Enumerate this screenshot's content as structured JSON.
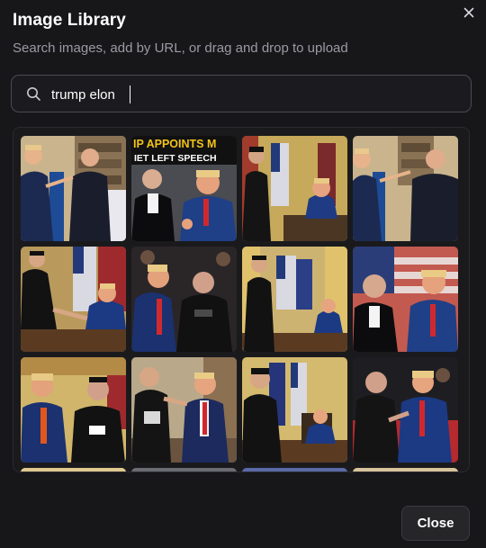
{
  "dialog": {
    "title": "Image Library",
    "subtitle": "Search images, add by URL, or drag and drop to upload"
  },
  "search": {
    "value": "trump elon",
    "icon": "search-icon"
  },
  "thumb_text": {
    "banner_line1": "IP APPOINTS M",
    "banner_line2": "IET LEFT SPEECH"
  },
  "results": [
    {
      "scene": "bookshelf-pointing"
    },
    {
      "scene": "news-banner-tuxedo"
    },
    {
      "scene": "oval-office-flags"
    },
    {
      "scene": "bookshelf-pointing-2"
    },
    {
      "scene": "handshake-desk"
    },
    {
      "scene": "crowd-event"
    },
    {
      "scene": "oval-office-curtains"
    },
    {
      "scene": "tuxedo-flag-backdrop"
    },
    {
      "scene": "gold-curtains-shrug"
    },
    {
      "scene": "hand-on-shoulder"
    },
    {
      "scene": "resolute-desk"
    },
    {
      "scene": "red-stage"
    },
    {
      "scene": "partial-1"
    },
    {
      "scene": "partial-2"
    },
    {
      "scene": "partial-3"
    },
    {
      "scene": "partial-4"
    }
  ],
  "footer": {
    "close_label": "Close"
  },
  "colors": {
    "background": "#17171a",
    "border": "#4a4a52",
    "muted_text": "#9a9aa2",
    "button_bg": "#262629"
  }
}
